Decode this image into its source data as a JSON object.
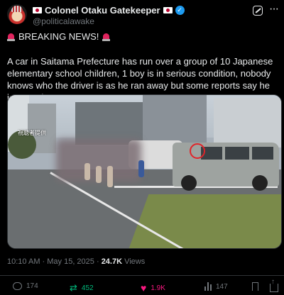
{
  "post": {
    "author_name": "Colonel Otaku Gatekeeper",
    "handle": "@politicalawake",
    "headline": "BREAKING NEWS!",
    "body": "A car in Saitama Prefecture has run over a group of 10 Japanese elementary school children, 1 boy is in serious condition, nobody knows who the driver is as he ran away but some reports say he is a Kurd.",
    "media_caption": "視聴者提供",
    "timestamp": "10:10 AM · May 15, 2025 · ",
    "views_count": "24.7K",
    "views_label": " Views"
  },
  "actions": {
    "replies": "174",
    "reposts": "452",
    "likes": "1.9K",
    "views": "147"
  },
  "icons": {
    "verified": "verified-badge",
    "grok": "grok-icon",
    "more": "more-icon",
    "reply": "reply-icon",
    "repost": "repost-icon",
    "like": "heart-icon",
    "views": "views-icon",
    "bookmark": "bookmark-icon",
    "share": "share-icon"
  },
  "colors": {
    "background": "#000000",
    "text": "#e7e9ea",
    "muted": "#71767b",
    "verified": "#1d9bf0",
    "repost_active": "#00ba7c",
    "like_active": "#f91880",
    "annotation_circle": "#e0242a"
  }
}
